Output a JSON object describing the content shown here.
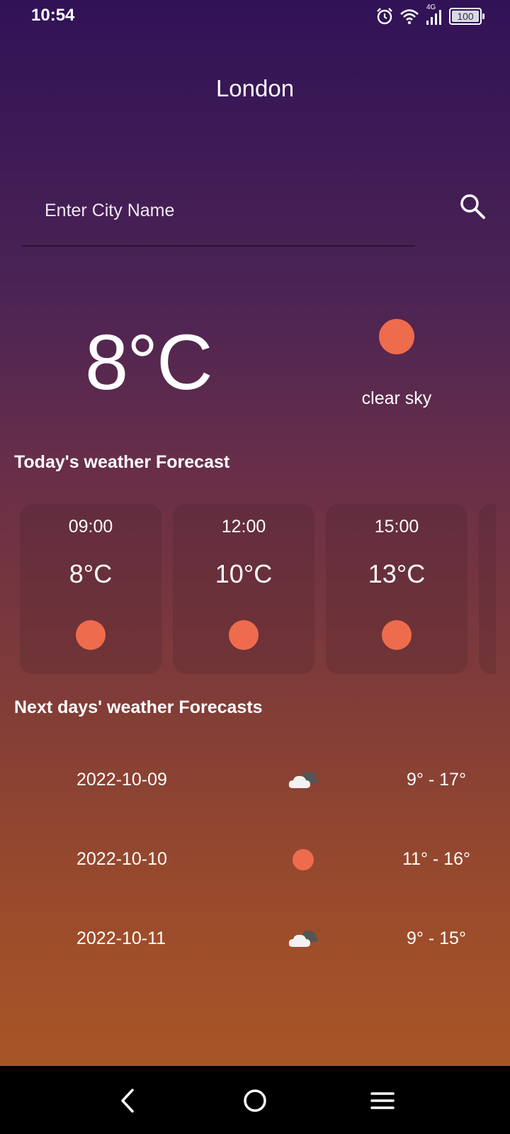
{
  "status_bar": {
    "time": "10:54",
    "network": "4G",
    "battery": "100",
    "icons": [
      "alarm-icon",
      "wifi-icon",
      "signal-icon",
      "battery-icon"
    ]
  },
  "city": "London",
  "search": {
    "placeholder": "Enter City Name",
    "value": "",
    "icon": "search-icon"
  },
  "current": {
    "temperature": "8°C",
    "description": "clear sky",
    "icon": "sun-icon"
  },
  "today": {
    "heading": "Today's weather Forecast",
    "hours": [
      {
        "time": "09:00",
        "temp": "8°C",
        "icon": "sun-icon"
      },
      {
        "time": "12:00",
        "temp": "10°C",
        "icon": "sun-icon"
      },
      {
        "time": "15:00",
        "temp": "13°C",
        "icon": "sun-icon"
      }
    ]
  },
  "next_days": {
    "heading": "Next days' weather Forecasts",
    "days": [
      {
        "date": "2022-10-09",
        "range": "9° - 17°",
        "icon": "cloud-icon"
      },
      {
        "date": "2022-10-10",
        "range": "11° - 16°",
        "icon": "sun-icon"
      },
      {
        "date": "2022-10-11",
        "range": "9° - 15°",
        "icon": "cloud-icon"
      }
    ]
  },
  "nav": {
    "icons": [
      "back-icon",
      "home-icon",
      "menu-icon"
    ]
  },
  "colors": {
    "sun": "#ee6c4d",
    "gradient_top": "#311257",
    "gradient_bottom": "#a85527",
    "nav_bar": "#000000"
  }
}
